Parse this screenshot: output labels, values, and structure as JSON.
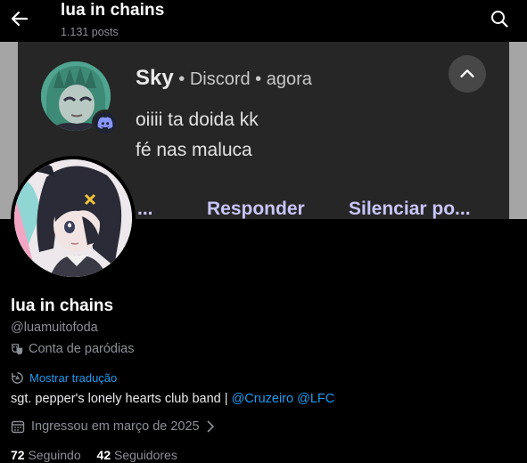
{
  "header": {
    "title": "lua in chains",
    "post_count": "1.131 posts",
    "back_icon": "arrow-left-icon",
    "search_icon": "search-icon"
  },
  "banner": {
    "notification": {
      "sender": "Sky",
      "source": "• Discord • agora",
      "line1": "oiiii ta doida kk",
      "line2": "fé nas maluca",
      "action_more": "...",
      "action_reply": "Responder",
      "action_mute": "Silenciar po..."
    }
  },
  "profile": {
    "name": "lua in chains",
    "handle": "@luamuitofoda",
    "parody_label": "Conta de paródias",
    "translate_label": "Mostrar tradução",
    "bio_text": "sgt. pepper's lonely hearts club band | ",
    "bio_link1": "@Cruzeiro",
    "bio_link2": "@LFC",
    "joined": "Ingressou em março de 2025",
    "following_count": "72",
    "following_label": "Seguindo",
    "followers_count": "42",
    "followers_label": "Seguidores"
  },
  "colors": {
    "background": "#000000",
    "link": "#1d9bf0",
    "muted_text": "#8b9096",
    "notification_bg": "#262626",
    "notification_action": "#c7c5f9"
  }
}
